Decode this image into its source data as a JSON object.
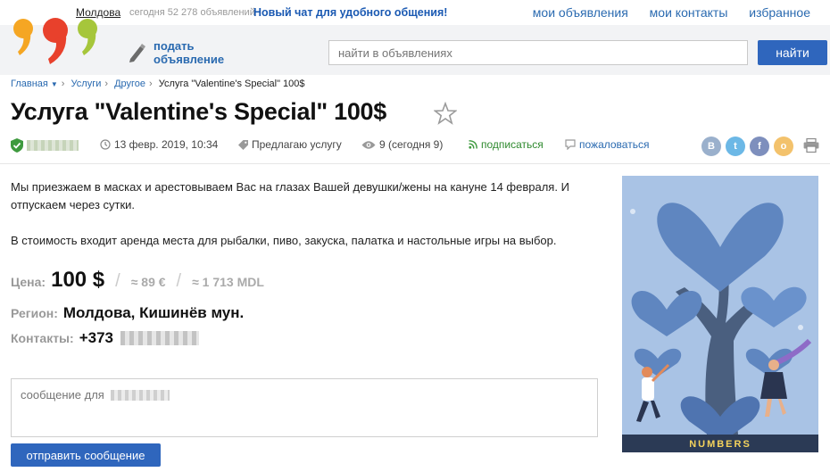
{
  "topbar": {
    "region": "Молдова",
    "today_count": "сегодня 52 278 объявлений",
    "promo": "Новый чат для удобного общения!",
    "links": [
      "мои объявления",
      "мои контакты",
      "избранное"
    ]
  },
  "header": {
    "post_ad_line1": "подать",
    "post_ad_line2": "объявление",
    "search_placeholder": "найти в объявлениях",
    "search_button": "найти"
  },
  "breadcrumb": [
    "Главная",
    "Услуги",
    "Другое",
    "Услуга \"Valentine's Special\" 100$"
  ],
  "listing": {
    "title": "Услуга \"Valentine's Special\" 100$",
    "date": "13 февр. 2019, 10:34",
    "offer_type": "Предлагаю услугу",
    "views": "9 (сегодня 9)",
    "subscribe": "подписаться",
    "report": "пожаловаться",
    "social": [
      "В",
      "t",
      "f",
      "о"
    ],
    "description": [
      "Мы приезжаем в масках и арестовываем Вас на глазах Вашей девушки/жены на кануне 14 февраля. И отпускаем через сутки.",
      "В стоимость входит аренда места для рыбалки, пиво, закуска, палатка и настольные игры на выбор."
    ],
    "price_label": "Цена:",
    "price": "100 $",
    "price_eur": "≈ 89 €",
    "price_mdl": "≈ 1 713 MDL",
    "region_label": "Регион:",
    "region": "Молдова, Кишинёв мун.",
    "contacts_label": "Контакты:",
    "phone_prefix": "+373"
  },
  "message": {
    "placeholder": "сообщение для",
    "send_button": "отправить сообщение"
  },
  "image": {
    "caption": "NUMBERS"
  },
  "colors": {
    "accent": "#2f66bd",
    "link": "#2a6ab0",
    "logo_orange": "#f5a623",
    "logo_red": "#e8412c",
    "logo_green": "#a6c63b"
  }
}
